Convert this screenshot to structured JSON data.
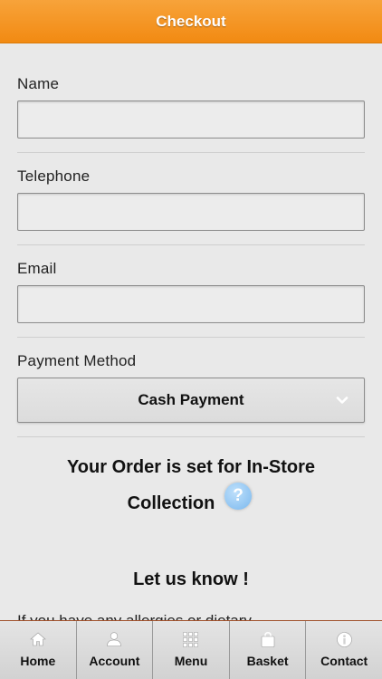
{
  "header": {
    "title": "Checkout"
  },
  "form": {
    "name_label": "Name",
    "name_value": "",
    "telephone_label": "Telephone",
    "telephone_value": "",
    "email_label": "Email",
    "email_value": "",
    "payment_label": "Payment Method",
    "payment_selected": "Cash Payment"
  },
  "order": {
    "note_line1": "Your Order is set for In-Store",
    "note_line2": "Collection",
    "help_glyph": "?",
    "let_us_know": "Let us know !",
    "allergy_text": "If you have any allergies or dietary"
  },
  "tabbar": {
    "tabs": [
      {
        "label": "Home",
        "icon": "home-icon"
      },
      {
        "label": "Account",
        "icon": "user-icon"
      },
      {
        "label": "Menu",
        "icon": "grid-icon"
      },
      {
        "label": "Basket",
        "icon": "bag-icon"
      },
      {
        "label": "Contact",
        "icon": "info-icon"
      }
    ]
  },
  "colors": {
    "header_bg": "#f28a12",
    "page_bg": "#e9e9e9",
    "help_icon": "#7ab8ee"
  }
}
